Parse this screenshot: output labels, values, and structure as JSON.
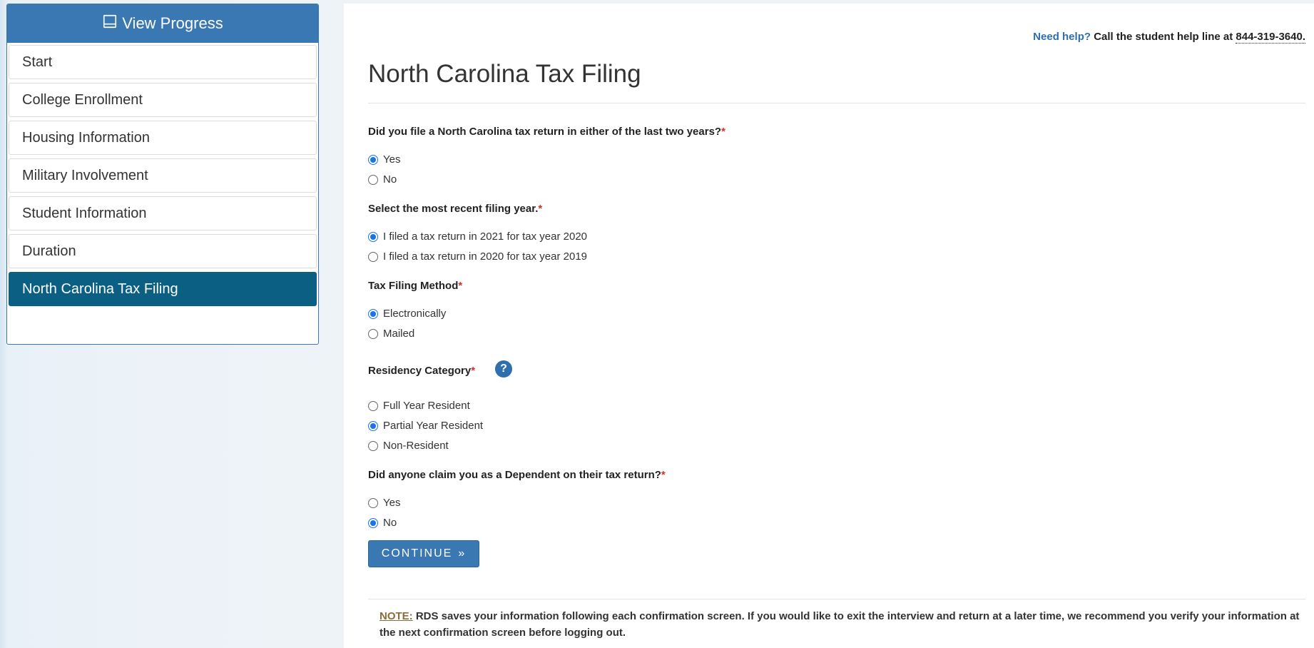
{
  "sidebar": {
    "header": "View Progress",
    "steps": [
      "Start",
      "College Enrollment",
      "Housing Information",
      "Military Involvement",
      "Student Information",
      "Duration",
      "North Carolina Tax Filing"
    ],
    "active_step": "North Carolina Tax Filing"
  },
  "help": {
    "link": "Need help?",
    "text": "Call the student help line at",
    "phone": "844-319-3640."
  },
  "page_title": "North Carolina Tax Filing",
  "questions": {
    "q1": {
      "label": "Did you file a North Carolina tax return in either of the last two years?",
      "required": "*",
      "options": [
        "Yes",
        "No"
      ],
      "selected": "Yes"
    },
    "q2": {
      "label": "Select the most recent filing year.",
      "required": "*",
      "options": [
        "I filed a tax return in 2021 for tax year 2020",
        "I filed a tax return in 2020 for tax year 2019"
      ],
      "selected": "I filed a tax return in 2021 for tax year 2020"
    },
    "q3": {
      "label": "Tax Filing Method",
      "required": "*",
      "options": [
        "Electronically",
        "Mailed"
      ],
      "selected": "Electronically"
    },
    "q4": {
      "label": "Residency Category",
      "required": "*",
      "help_icon": "?",
      "options": [
        "Full Year Resident",
        "Partial Year Resident",
        "Non-Resident"
      ],
      "selected": "Partial Year Resident"
    },
    "q5": {
      "label": "Did anyone claim you as a Dependent on their tax return?",
      "required": "*",
      "options": [
        "Yes",
        "No"
      ],
      "selected": "No"
    }
  },
  "continue_label": "CONTINUE",
  "continue_icon": "»",
  "note": {
    "label": "NOTE:",
    "text": " RDS saves your information following each confirmation screen. If you would like to exit the interview and return at a later time, we recommend you verify your information at the next confirmation screen before logging out."
  },
  "colors": {
    "primary": "#3a78b4",
    "active_step": "#0a5f82",
    "required": "#d0312d",
    "radio_checked": "#1a73e8"
  }
}
